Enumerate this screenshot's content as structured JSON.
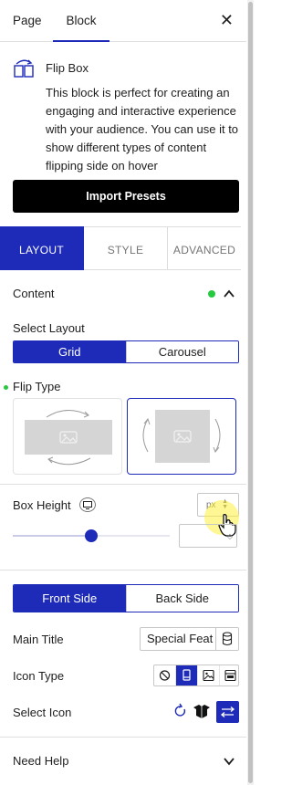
{
  "top_tabs": {
    "page": "Page",
    "block": "Block",
    "active": "Block"
  },
  "block": {
    "icon": "flip-box-icon",
    "title": "Flip Box",
    "description": "This block is perfect for creating an engaging and interactive experience with your audience. You can use it to show different types of content flipping side on hover"
  },
  "import_button": "Import Presets",
  "panel_tabs": {
    "layout": "LAYOUT",
    "style": "STYLE",
    "advanced": "ADVANCED",
    "active": "LAYOUT"
  },
  "content_section": {
    "title": "Content",
    "expanded": true
  },
  "select_layout": {
    "label": "Select Layout",
    "options": [
      "Grid",
      "Carousel"
    ],
    "selected": "Grid"
  },
  "flip_type": {
    "label": "Flip Type",
    "options": [
      "horizontal-flip",
      "vertical-flip"
    ],
    "selected": "vertical-flip"
  },
  "box_height": {
    "label": "Box Height",
    "unit": "px",
    "value_fraction": 0.5,
    "value": ""
  },
  "side_toggle": {
    "options": [
      "Front Side",
      "Back Side"
    ],
    "selected": "Front Side"
  },
  "main_title": {
    "label": "Main Title",
    "value": "Special Feat"
  },
  "icon_type": {
    "label": "Icon Type",
    "options": [
      "none-icon",
      "icon-icon",
      "image-icon",
      "svg-icon"
    ],
    "selected": "icon-icon"
  },
  "select_icon": {
    "label": "Select Icon",
    "icons": [
      "reset-icon",
      "box-open-icon",
      "swap-icon"
    ]
  },
  "need_help": {
    "title": "Need Help",
    "expanded": false
  },
  "colors": {
    "accent": "#1d2bb8",
    "status_dot": "#28c840",
    "button_dark": "#000000"
  }
}
